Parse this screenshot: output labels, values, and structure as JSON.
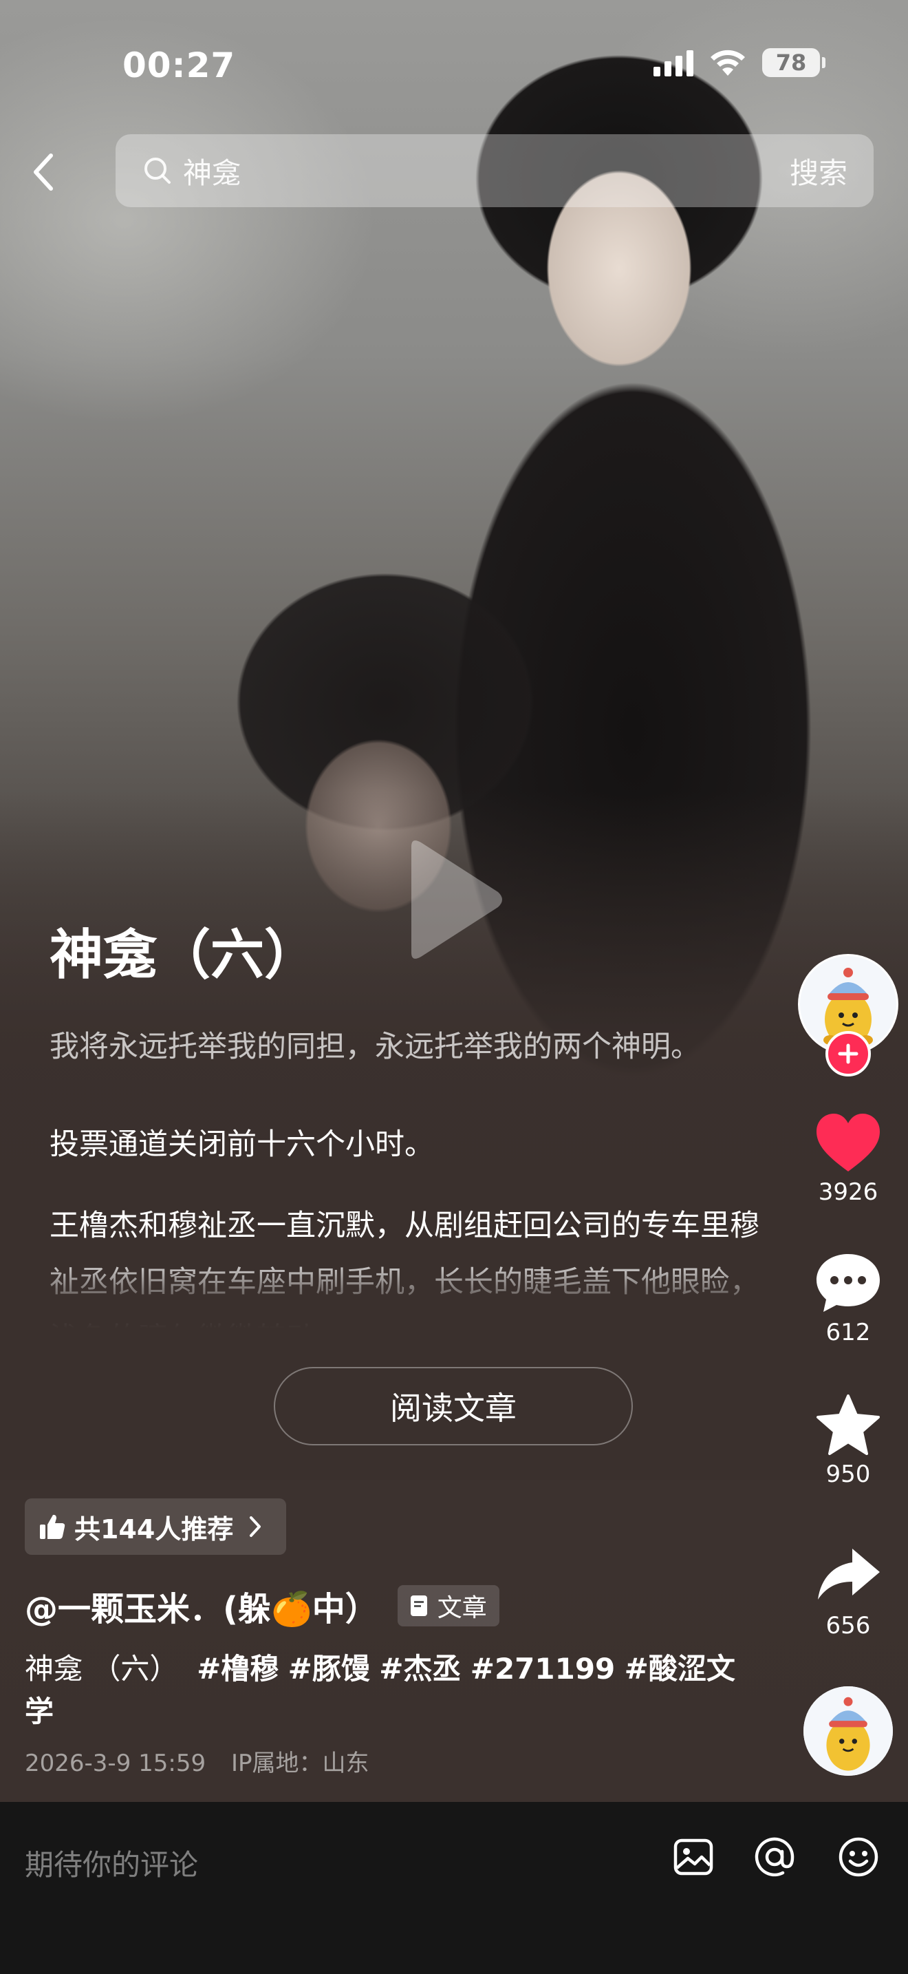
{
  "status": {
    "time": "00:27",
    "battery": "78"
  },
  "header": {
    "search_query": "神龛",
    "search_button": "搜索"
  },
  "article": {
    "title": "神龛（六）",
    "paragraph1": "我将永远托举我的同担，永远托举我的两个神明。",
    "paragraph2": "投票通道关闭前十六个小时。",
    "paragraph3": "王橹杰和穆祉丞一直沉默，从剧组赶回公司的专车里穆祉丞依旧窝在车座中刷手机，长长的睫毛盖下他眼睑，浅色的瞳仁微微转动"
  },
  "read_button": "阅读文章",
  "recommend": {
    "label": "共144人推荐"
  },
  "author": {
    "name": "@一颗玉米．(躲🍊中）",
    "tag": "文章"
  },
  "description": {
    "title_part": "神龛 （六）",
    "hashtags": [
      "#橹穆",
      "#豚馒",
      "#杰丞",
      "#271199",
      "#酸涩文学"
    ]
  },
  "meta": {
    "date": "2026-3-9 15:59",
    "ip": "IP属地：山东"
  },
  "actions": {
    "likes": "3926",
    "comments": "612",
    "favorites": "950",
    "shares": "656"
  },
  "comment_bar": {
    "placeholder": "期待你的评论"
  },
  "colors": {
    "like": "#fe2c55",
    "background": "#3a302d",
    "bottom_bar": "#161616"
  }
}
